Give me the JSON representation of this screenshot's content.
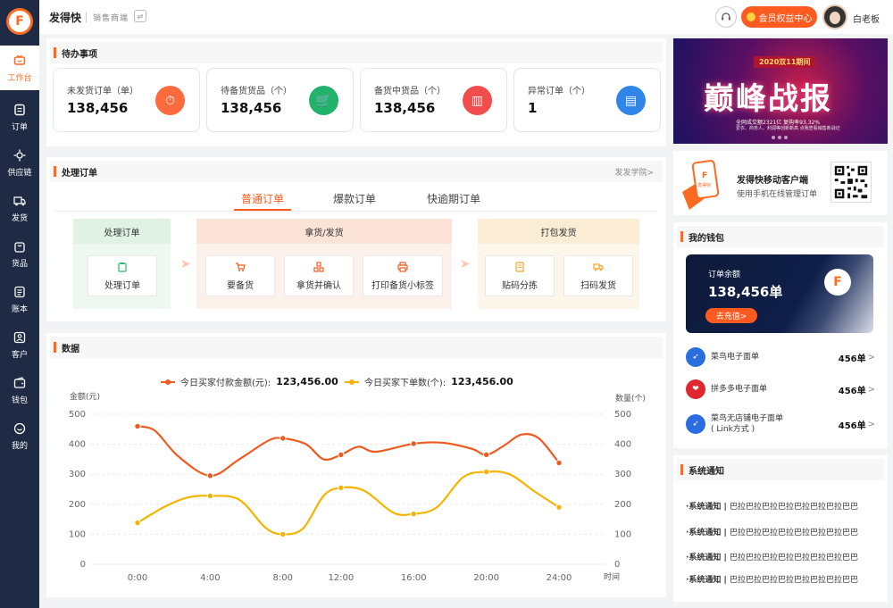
{
  "app": {
    "name": "发得快",
    "subtitle": "销售商端"
  },
  "header": {
    "member_button": "会员权益中心",
    "user_name": "白老板"
  },
  "sidebar": {
    "items": [
      {
        "label": "工作台",
        "icon": "tv-icon",
        "active": true
      },
      {
        "label": "订单",
        "icon": "order-icon"
      },
      {
        "label": "供应链",
        "icon": "supply-chain-icon"
      },
      {
        "label": "发货",
        "icon": "truck-icon"
      },
      {
        "label": "货品",
        "icon": "bag-icon"
      },
      {
        "label": "账本",
        "icon": "ledger-icon"
      },
      {
        "label": "客户",
        "icon": "customer-icon"
      },
      {
        "label": "钱包",
        "icon": "wallet-icon"
      },
      {
        "label": "我的",
        "icon": "smile-icon"
      }
    ]
  },
  "todo": {
    "title": "待办事项",
    "cards": [
      {
        "label": "未发货订单（单）",
        "value": "138,456",
        "icon": "clock-truck-icon",
        "color": "#ff6b3d"
      },
      {
        "label": "待备货货品（个）",
        "value": "138,456",
        "icon": "cart-clock-icon",
        "color": "#21b36b"
      },
      {
        "label": "备货中货品（个）",
        "value": "138,456",
        "icon": "basket-icon",
        "color": "#f24d4d"
      },
      {
        "label": "异常订单（个）",
        "value": "1",
        "icon": "document-icon",
        "color": "#2f86e8"
      }
    ]
  },
  "process": {
    "title": "处理订单",
    "help_link": "发发学院>",
    "tabs": [
      "普通订单",
      "爆款订单",
      "快逾期订单"
    ],
    "groups": [
      {
        "title": "处理订单",
        "color": "#e8f6ec",
        "title_color": "#dff2e4",
        "steps": [
          {
            "label": "处理订单",
            "icon": "clipboard-icon"
          }
        ]
      },
      {
        "title": "拿货/发货",
        "color": "#fdf0ea",
        "title_color": "#fbe3d8",
        "steps": [
          {
            "label": "要备货",
            "icon": "cart-icon"
          },
          {
            "label": "拿货并确认",
            "icon": "boxes-icon"
          },
          {
            "label": "打印备货小标签",
            "icon": "printer-icon"
          }
        ]
      },
      {
        "title": "打包发货",
        "color": "#fdf5e8",
        "title_color": "#fbecd6",
        "steps": [
          {
            "label": "贴码分拣",
            "icon": "label-icon"
          },
          {
            "label": "扫码发货",
            "icon": "truck-icon"
          }
        ]
      }
    ]
  },
  "data_section": {
    "title": "数据"
  },
  "chart_data": {
    "type": "line",
    "x": [
      "0:00",
      "4:00",
      "8:00",
      "12:00",
      "16:00",
      "20:00",
      "24:00"
    ],
    "x_numeric": [
      0,
      2.5,
      5,
      7,
      9.5,
      12,
      14.5
    ],
    "xlabel": "时间",
    "ylabel_left": "金额(元)",
    "ylabel_right": "数量(个)",
    "ylim": [
      0,
      500
    ],
    "yticks": [
      0,
      100,
      200,
      300,
      400,
      500
    ],
    "grid": true,
    "legend_position": "top-center",
    "series": [
      {
        "name": "今日买家付款金额(元):",
        "total": "123,456.00",
        "color": "#f05a1e",
        "points": [
          [
            0,
            460
          ],
          [
            2.5,
            295
          ],
          [
            5,
            420
          ],
          [
            7,
            365
          ],
          [
            9.5,
            402
          ],
          [
            12,
            365
          ],
          [
            14.5,
            338
          ]
        ],
        "curve": [
          [
            0,
            460
          ],
          [
            0.6,
            445
          ],
          [
            1.4,
            360
          ],
          [
            2.5,
            295
          ],
          [
            3.5,
            350
          ],
          [
            4.5,
            412
          ],
          [
            5,
            420
          ],
          [
            5.8,
            400
          ],
          [
            6.4,
            350
          ],
          [
            7,
            365
          ],
          [
            7.6,
            392
          ],
          [
            8.2,
            375
          ],
          [
            9.5,
            402
          ],
          [
            10.5,
            405
          ],
          [
            11.5,
            385
          ],
          [
            12,
            365
          ],
          [
            12.6,
            395
          ],
          [
            13.2,
            432
          ],
          [
            13.8,
            420
          ],
          [
            14.5,
            338
          ]
        ]
      },
      {
        "name": "今日买家下单数(个):",
        "total": "123,456.00",
        "color": "#f5b400",
        "points": [
          [
            0,
            138
          ],
          [
            2.5,
            228
          ],
          [
            5,
            100
          ],
          [
            7,
            255
          ],
          [
            9.5,
            168
          ],
          [
            12,
            308
          ],
          [
            14.5,
            190
          ]
        ],
        "curve": [
          [
            0,
            138
          ],
          [
            0.9,
            190
          ],
          [
            1.7,
            222
          ],
          [
            2.5,
            228
          ],
          [
            3.5,
            215
          ],
          [
            4.4,
            122
          ],
          [
            5,
            100
          ],
          [
            5.7,
            120
          ],
          [
            6.4,
            228
          ],
          [
            7,
            255
          ],
          [
            7.8,
            245
          ],
          [
            8.8,
            172
          ],
          [
            9.5,
            168
          ],
          [
            10.3,
            190
          ],
          [
            11.2,
            290
          ],
          [
            12,
            308
          ],
          [
            12.8,
            300
          ],
          [
            13.7,
            240
          ],
          [
            14.5,
            190
          ]
        ]
      }
    ]
  },
  "banner": {
    "top_label": "2020双11期间",
    "title": "巅峰战报",
    "line1": "全网成交额2321亿  复购率93.32%",
    "line2": "爱衣、商务人、利润等创新新高 点我查看销售新战记"
  },
  "mobile": {
    "title": "发得快移动客户端",
    "subtitle": "使用手机在线管理订单",
    "phone_label": "发得快"
  },
  "wallet": {
    "title": "我的钱包",
    "balance_label": "订单余额",
    "balance_value": "138,456单",
    "recharge": "去充值>",
    "rows": [
      {
        "name": "菜鸟电子面单",
        "count": "456单",
        "chevron": ">",
        "icon": "cainiao-icon",
        "color": "#2a6de0"
      },
      {
        "name": "拼多多电子面单",
        "count": "456单",
        "chevron": ">",
        "icon": "pinduoduo-icon",
        "color": "#e0262f"
      },
      {
        "name": "菜鸟无店铺电子面单\n( Link方式 )",
        "count": "456单",
        "chevron": ">",
        "icon": "cainiao-icon",
        "color": "#2a6de0"
      }
    ]
  },
  "notices": {
    "title": "系统通知",
    "items": [
      {
        "prefix": "·系统通知 | ",
        "text": "巴拉巴拉巴拉巴拉巴拉巴拉巴拉巴巴"
      },
      {
        "prefix": "·系统通知 | ",
        "text": "巴拉巴拉巴拉巴拉巴拉巴拉巴拉巴巴"
      },
      {
        "prefix": "·系统通知 | ",
        "text": "巴拉巴拉巴拉巴拉巴拉巴拉巴拉巴巴"
      },
      {
        "prefix": "·系统通知 | ",
        "text": "巴拉巴拉巴拉巴拉巴拉巴拉巴拉巴巴"
      }
    ]
  }
}
